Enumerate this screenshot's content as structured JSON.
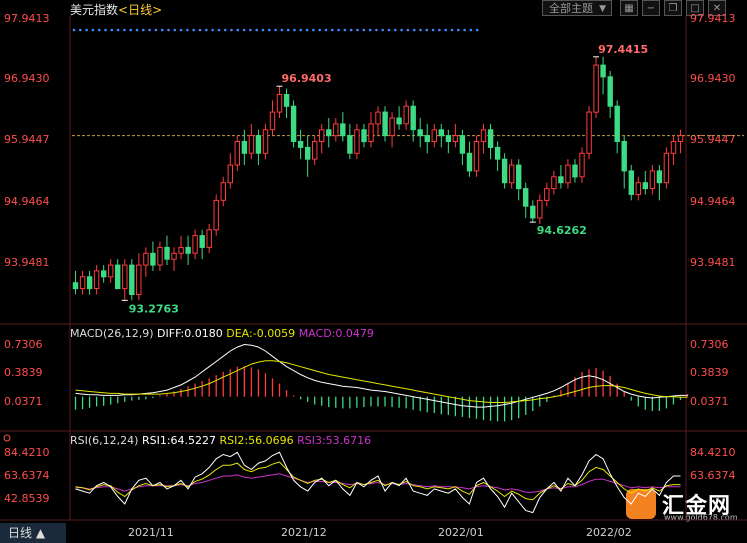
{
  "header": {
    "title": "美元指数",
    "period": "<日线>",
    "menu_label": "全部主题",
    "menu_arrow": "▼"
  },
  "axes": {
    "price_left": [
      "97.9413",
      "96.9430",
      "95.9447",
      "94.9464",
      "93.9481"
    ],
    "price_right": [
      "97.9413",
      "96.9430",
      "95.9447",
      "94.9464",
      "93.9481"
    ],
    "macd_levels": [
      "0.7306",
      "0.3839",
      "0.0371"
    ],
    "rsi_levels": [
      "84.4210",
      "63.6374",
      "42.8539"
    ],
    "dates": [
      "2021/11",
      "2021/12",
      "2022/01",
      "2022/02"
    ]
  },
  "indicators": {
    "macd": {
      "name": "MACD(26,12,9)",
      "diff": "DIFF:0.0180",
      "dea": "DEA:-0.0059",
      "macd": "MACD:0.0479"
    },
    "rsi": {
      "name": "RSI(6,12,24)",
      "rsi1": "RSI1:64.5227",
      "rsi2": "RSI2:56.0696",
      "rsi3": "RSI3:53.6716"
    }
  },
  "annotations": {
    "high": "96.9403",
    "peak": "97.4415",
    "low1": "93.2763",
    "low2": "94.6262"
  },
  "bottom_tab": "日线 ▲",
  "logo": {
    "text": "汇金网",
    "url": "www.gold678.com"
  },
  "colors": {
    "up": "#ff3b3b",
    "down": "#3ddc84",
    "dif": "#ffffff",
    "dea": "#e6e600",
    "rsi1": "#ffffff",
    "rsi2": "#e6e600",
    "rsi3": "#cc33cc"
  },
  "chart_data": {
    "type": "candlestick",
    "ylim": [
      93.0,
      98.1
    ],
    "candles": [
      [
        93.6,
        93.5,
        93.8,
        93.4
      ],
      [
        93.5,
        93.7,
        93.8,
        93.4
      ],
      [
        93.7,
        93.5,
        93.8,
        93.4
      ],
      [
        93.5,
        93.8,
        93.9,
        93.4
      ],
      [
        93.8,
        93.7,
        93.9,
        93.6
      ],
      [
        93.7,
        93.9,
        94.0,
        93.6
      ],
      [
        93.9,
        93.5,
        94.0,
        93.5
      ],
      [
        93.5,
        93.9,
        94.0,
        93.3
      ],
      [
        93.9,
        93.4,
        94.0,
        93.3
      ],
      [
        93.4,
        93.9,
        94.1,
        93.3
      ],
      [
        93.9,
        94.1,
        94.2,
        93.7
      ],
      [
        94.1,
        93.9,
        94.3,
        93.8
      ],
      [
        93.9,
        94.2,
        94.3,
        93.8
      ],
      [
        94.2,
        94.0,
        94.4,
        93.9
      ],
      [
        94.0,
        94.1,
        94.2,
        93.8
      ],
      [
        94.1,
        94.2,
        94.4,
        94.0
      ],
      [
        94.2,
        94.1,
        94.4,
        93.9
      ],
      [
        94.1,
        94.4,
        94.5,
        94.0
      ],
      [
        94.4,
        94.2,
        94.5,
        94.0
      ],
      [
        94.2,
        94.5,
        94.6,
        94.1
      ],
      [
        94.5,
        95.0,
        95.1,
        94.4
      ],
      [
        95.0,
        95.3,
        95.4,
        94.9
      ],
      [
        95.3,
        95.6,
        95.8,
        95.2
      ],
      [
        95.6,
        96.0,
        96.1,
        95.5
      ],
      [
        96.0,
        95.8,
        96.2,
        95.6
      ],
      [
        95.8,
        96.1,
        96.3,
        95.7
      ],
      [
        96.1,
        95.8,
        96.2,
        95.6
      ],
      [
        95.8,
        96.2,
        96.3,
        95.7
      ],
      [
        96.2,
        96.5,
        96.7,
        96.1
      ],
      [
        96.5,
        96.8,
        96.94,
        96.4
      ],
      [
        96.8,
        96.6,
        96.9,
        96.4
      ],
      [
        96.6,
        96.0,
        96.7,
        95.9
      ],
      [
        96.0,
        95.9,
        96.2,
        95.7
      ],
      [
        95.9,
        95.7,
        96.1,
        95.4
      ],
      [
        95.7,
        96.0,
        96.1,
        95.6
      ],
      [
        96.0,
        96.2,
        96.3,
        95.8
      ],
      [
        96.2,
        96.1,
        96.4,
        95.9
      ],
      [
        96.1,
        96.3,
        96.4,
        96.0
      ],
      [
        96.3,
        96.1,
        96.5,
        96.0
      ],
      [
        96.1,
        95.8,
        96.3,
        95.7
      ],
      [
        95.8,
        96.2,
        96.3,
        95.7
      ],
      [
        96.2,
        96.0,
        96.3,
        95.9
      ],
      [
        96.0,
        96.3,
        96.5,
        95.9
      ],
      [
        96.3,
        96.5,
        96.6,
        96.1
      ],
      [
        96.5,
        96.1,
        96.6,
        96.0
      ],
      [
        96.1,
        96.4,
        96.5,
        95.9
      ],
      [
        96.4,
        96.3,
        96.6,
        96.2
      ],
      [
        96.3,
        96.6,
        96.7,
        96.2
      ],
      [
        96.6,
        96.2,
        96.7,
        96.0
      ],
      [
        96.2,
        96.1,
        96.4,
        95.9
      ],
      [
        96.1,
        96.0,
        96.3,
        95.8
      ],
      [
        96.0,
        96.2,
        96.3,
        95.9
      ],
      [
        96.2,
        96.1,
        96.3,
        95.9
      ],
      [
        96.1,
        96.0,
        96.2,
        95.8
      ],
      [
        96.0,
        96.1,
        96.3,
        95.9
      ],
      [
        96.1,
        95.8,
        96.2,
        95.6
      ],
      [
        95.8,
        95.5,
        96.0,
        95.4
      ],
      [
        95.5,
        96.0,
        96.1,
        95.4
      ],
      [
        96.0,
        96.2,
        96.3,
        95.8
      ],
      [
        96.2,
        95.9,
        96.3,
        95.7
      ],
      [
        95.9,
        95.7,
        96.0,
        95.5
      ],
      [
        95.7,
        95.3,
        95.8,
        95.2
      ],
      [
        95.3,
        95.6,
        95.7,
        95.2
      ],
      [
        95.6,
        95.2,
        95.7,
        95.0
      ],
      [
        95.2,
        94.9,
        95.3,
        94.7
      ],
      [
        94.9,
        94.7,
        95.0,
        94.63
      ],
      [
        94.7,
        95.0,
        95.1,
        94.6
      ],
      [
        95.0,
        95.2,
        95.3,
        94.9
      ],
      [
        95.2,
        95.4,
        95.5,
        95.1
      ],
      [
        95.4,
        95.3,
        95.6,
        95.2
      ],
      [
        95.3,
        95.6,
        95.7,
        95.2
      ],
      [
        95.6,
        95.4,
        95.7,
        95.3
      ],
      [
        95.4,
        95.8,
        95.9,
        95.3
      ],
      [
        95.8,
        96.5,
        96.6,
        95.7
      ],
      [
        96.5,
        97.3,
        97.44,
        96.4
      ],
      [
        97.3,
        97.1,
        97.44,
        96.8
      ],
      [
        97.1,
        96.6,
        97.2,
        96.4
      ],
      [
        96.6,
        96.0,
        96.7,
        95.8
      ],
      [
        96.0,
        95.5,
        96.1,
        95.2
      ],
      [
        95.5,
        95.1,
        95.6,
        95.0
      ],
      [
        95.1,
        95.3,
        95.4,
        95.0
      ],
      [
        95.3,
        95.2,
        95.5,
        95.1
      ],
      [
        95.2,
        95.5,
        95.6,
        95.1
      ],
      [
        95.5,
        95.3,
        95.6,
        95.0
      ],
      [
        95.3,
        95.8,
        95.9,
        95.2
      ],
      [
        95.8,
        96.0,
        96.1,
        95.6
      ],
      [
        96.0,
        96.1,
        96.2,
        95.8
      ]
    ],
    "macd_hist": [
      -0.2,
      -0.19,
      -0.17,
      -0.15,
      -0.14,
      -0.12,
      -0.1,
      -0.08,
      -0.06,
      -0.05,
      -0.04,
      -0.02,
      0.02,
      0.05,
      0.08,
      0.12,
      0.16,
      0.2,
      0.24,
      0.28,
      0.33,
      0.38,
      0.42,
      0.46,
      0.47,
      0.45,
      0.42,
      0.36,
      0.28,
      0.2,
      0.1,
      0.02,
      -0.04,
      -0.08,
      -0.12,
      -0.14,
      -0.16,
      -0.17,
      -0.18,
      -0.18,
      -0.17,
      -0.16,
      -0.15,
      -0.15,
      -0.15,
      -0.16,
      -0.17,
      -0.18,
      -0.2,
      -0.22,
      -0.24,
      -0.25,
      -0.27,
      -0.28,
      -0.3,
      -0.31,
      -0.33,
      -0.34,
      -0.36,
      -0.37,
      -0.38,
      -0.38,
      -0.36,
      -0.33,
      -0.28,
      -0.22,
      -0.15,
      -0.08,
      0.02,
      0.1,
      0.2,
      0.3,
      0.38,
      0.42,
      0.44,
      0.4,
      0.32,
      0.2,
      0.08,
      -0.06,
      -0.15,
      -0.2,
      -0.22,
      -0.22,
      -0.18,
      -0.12,
      -0.05,
      0.04
    ],
    "dif": [
      0.05,
      0.04,
      0.03,
      0.03,
      0.02,
      0.02,
      0.02,
      0.03,
      0.03,
      0.04,
      0.05,
      0.06,
      0.08,
      0.1,
      0.14,
      0.18,
      0.24,
      0.3,
      0.38,
      0.46,
      0.54,
      0.62,
      0.7,
      0.76,
      0.8,
      0.79,
      0.76,
      0.7,
      0.62,
      0.54,
      0.46,
      0.4,
      0.34,
      0.29,
      0.25,
      0.22,
      0.2,
      0.18,
      0.16,
      0.15,
      0.14,
      0.12,
      0.1,
      0.09,
      0.08,
      0.06,
      0.04,
      0.02,
      0.0,
      -0.02,
      -0.04,
      -0.06,
      -0.08,
      -0.1,
      -0.12,
      -0.14,
      -0.15,
      -0.16,
      -0.16,
      -0.15,
      -0.14,
      -0.12,
      -0.1,
      -0.07,
      -0.04,
      -0.01,
      0.02,
      0.05,
      0.09,
      0.14,
      0.2,
      0.26,
      0.3,
      0.32,
      0.3,
      0.26,
      0.2,
      0.14,
      0.08,
      0.04,
      0.01,
      -0.01,
      -0.02,
      -0.01,
      0.0,
      0.01,
      0.02,
      0.02
    ],
    "dea": [
      0.1,
      0.09,
      0.08,
      0.07,
      0.06,
      0.05,
      0.05,
      0.04,
      0.04,
      0.04,
      0.04,
      0.04,
      0.04,
      0.05,
      0.06,
      0.08,
      0.1,
      0.13,
      0.16,
      0.2,
      0.25,
      0.3,
      0.35,
      0.4,
      0.45,
      0.5,
      0.53,
      0.55,
      0.55,
      0.54,
      0.52,
      0.49,
      0.46,
      0.43,
      0.4,
      0.37,
      0.34,
      0.32,
      0.3,
      0.28,
      0.26,
      0.24,
      0.22,
      0.2,
      0.18,
      0.16,
      0.14,
      0.12,
      0.1,
      0.08,
      0.06,
      0.04,
      0.02,
      0.0,
      -0.02,
      -0.04,
      -0.06,
      -0.07,
      -0.08,
      -0.09,
      -0.09,
      -0.09,
      -0.08,
      -0.07,
      -0.06,
      -0.05,
      -0.03,
      -0.02,
      0.0,
      0.02,
      0.05,
      0.08,
      0.11,
      0.14,
      0.16,
      0.17,
      0.17,
      0.16,
      0.14,
      0.11,
      0.08,
      0.05,
      0.03,
      0.01,
      0.0,
      0.0,
      -0.01,
      -0.01
    ],
    "rsi1": [
      52,
      50,
      48,
      55,
      58,
      54,
      45,
      38,
      52,
      60,
      62,
      55,
      58,
      52,
      55,
      60,
      52,
      63,
      66,
      72,
      80,
      84,
      82,
      86,
      74,
      70,
      76,
      78,
      83,
      86,
      72,
      60,
      54,
      50,
      58,
      62,
      55,
      60,
      52,
      46,
      58,
      54,
      60,
      64,
      50,
      58,
      55,
      62,
      50,
      48,
      46,
      52,
      50,
      48,
      52,
      44,
      38,
      58,
      62,
      52,
      45,
      35,
      48,
      40,
      32,
      30,
      44,
      52,
      58,
      50,
      62,
      55,
      65,
      78,
      84,
      80,
      66,
      54,
      44,
      38,
      48,
      45,
      52,
      46,
      58,
      64,
      64
    ],
    "rsi2": [
      54,
      53,
      51,
      54,
      56,
      55,
      49,
      45,
      51,
      55,
      57,
      55,
      56,
      54,
      55,
      57,
      54,
      59,
      61,
      65,
      70,
      74,
      74,
      76,
      70,
      68,
      71,
      72,
      75,
      77,
      70,
      63,
      60,
      57,
      60,
      61,
      58,
      60,
      56,
      53,
      58,
      56,
      58,
      60,
      55,
      58,
      56,
      59,
      55,
      54,
      52,
      54,
      53,
      52,
      54,
      50,
      47,
      55,
      58,
      54,
      50,
      45,
      50,
      47,
      43,
      42,
      48,
      52,
      55,
      52,
      57,
      55,
      60,
      68,
      72,
      70,
      64,
      58,
      52,
      48,
      52,
      50,
      53,
      50,
      55,
      56,
      56
    ],
    "rsi3": [
      53,
      53,
      52,
      53,
      54,
      54,
      52,
      50,
      52,
      54,
      55,
      55,
      55,
      55,
      55,
      56,
      55,
      57,
      58,
      60,
      62,
      64,
      64,
      65,
      63,
      62,
      63,
      64,
      65,
      66,
      64,
      62,
      60,
      58,
      59,
      59,
      58,
      58,
      57,
      56,
      57,
      56,
      57,
      58,
      56,
      57,
      56,
      57,
      56,
      55,
      54,
      55,
      54,
      54,
      54,
      53,
      52,
      54,
      55,
      54,
      53,
      51,
      52,
      51,
      49,
      49,
      50,
      52,
      53,
      52,
      54,
      54,
      56,
      59,
      61,
      61,
      59,
      57,
      55,
      53,
      54,
      53,
      54,
      53,
      54,
      54,
      54
    ]
  }
}
